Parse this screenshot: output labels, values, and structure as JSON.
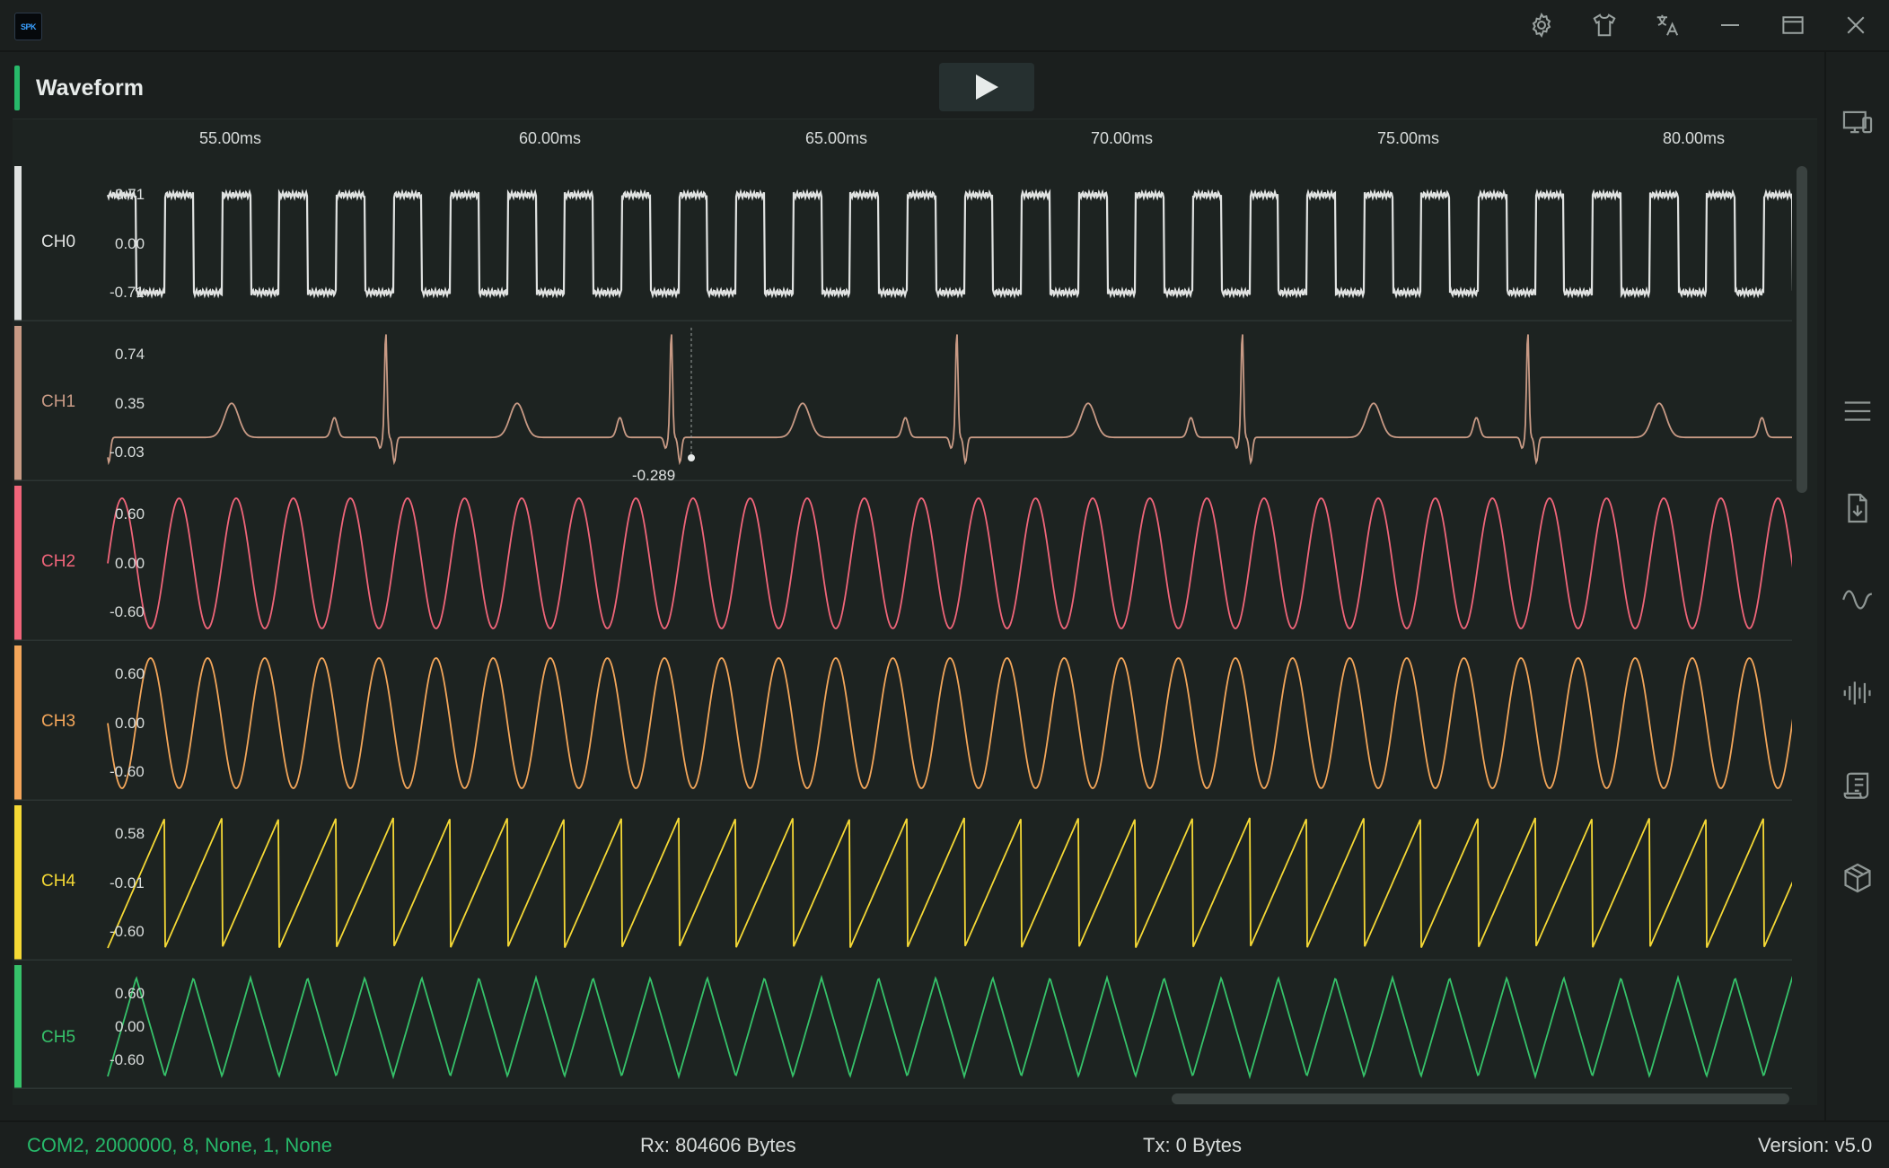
{
  "app": {
    "logo_text": "SPK"
  },
  "titlebar": {
    "buttons": [
      {
        "name": "settings-gear-icon"
      },
      {
        "name": "theme-shirt-icon"
      },
      {
        "name": "language-translate-icon"
      },
      {
        "name": "minimize-icon"
      },
      {
        "name": "maximize-icon"
      },
      {
        "name": "close-icon"
      }
    ]
  },
  "sidebar": {
    "buttons": [
      {
        "name": "devices-icon"
      },
      {
        "name": "menu-icon"
      },
      {
        "name": "download-file-icon"
      },
      {
        "name": "waveform-icon"
      },
      {
        "name": "spectrum-icon"
      },
      {
        "name": "log-scroll-icon"
      },
      {
        "name": "3d-box-icon"
      }
    ]
  },
  "panel": {
    "title": "Waveform",
    "play_button": "play-icon"
  },
  "time_axis": [
    "55.00ms",
    "60.00ms",
    "65.00ms",
    "70.00ms",
    "75.00ms",
    "80.00ms"
  ],
  "channels": [
    {
      "name": "CH0",
      "color": "#e0e2e1",
      "ticks": [
        "0.71",
        "0.00",
        "-0.71"
      ],
      "wave": "square"
    },
    {
      "name": "CH1",
      "color": "#c89a85",
      "ticks": [
        "0.74",
        "0.35",
        "-0.03"
      ],
      "wave": "ecg",
      "cursor_value": "-0.289"
    },
    {
      "name": "CH2",
      "color": "#f0657a",
      "ticks": [
        "0.60",
        "0.00",
        "-0.60"
      ],
      "wave": "sine"
    },
    {
      "name": "CH3",
      "color": "#f3a65a",
      "ticks": [
        "0.60",
        "0.00",
        "-0.60"
      ],
      "wave": "sine"
    },
    {
      "name": "CH4",
      "color": "#f5d935",
      "ticks": [
        "0.58",
        "-0.01",
        "-0.60"
      ],
      "wave": "saw"
    },
    {
      "name": "CH5",
      "color": "#36c26a",
      "ticks": [
        "0.60",
        "0.00",
        "-0.60"
      ],
      "wave": "triangle"
    }
  ],
  "status": {
    "port": "COM2, 2000000, 8, None, 1, None",
    "rx": "Rx: 804606 Bytes",
    "tx": "Tx: 0 Bytes",
    "version": "Version: v5.0",
    "port_color": "#27b96a"
  }
}
